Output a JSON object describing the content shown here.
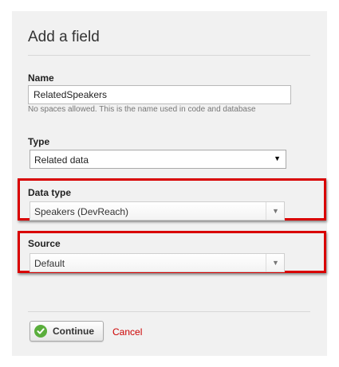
{
  "dialog": {
    "title": "Add a field"
  },
  "name_field": {
    "label": "Name",
    "value": "RelatedSpeakers",
    "hint": "No spaces allowed. This is the name used in code and database"
  },
  "type_field": {
    "label": "Type",
    "selected": "Related data"
  },
  "data_type_field": {
    "label": "Data type",
    "selected": "Speakers (DevReach)"
  },
  "source_field": {
    "label": "Source",
    "selected": "Default"
  },
  "actions": {
    "continue_label": "Continue",
    "cancel_label": "Cancel"
  },
  "colors": {
    "highlight": "#d90000",
    "cancel": "#cc0000",
    "check": "#5aae3c"
  },
  "icons": {
    "continue": "check-circle-icon",
    "dropdown": "chevron-down-icon"
  }
}
